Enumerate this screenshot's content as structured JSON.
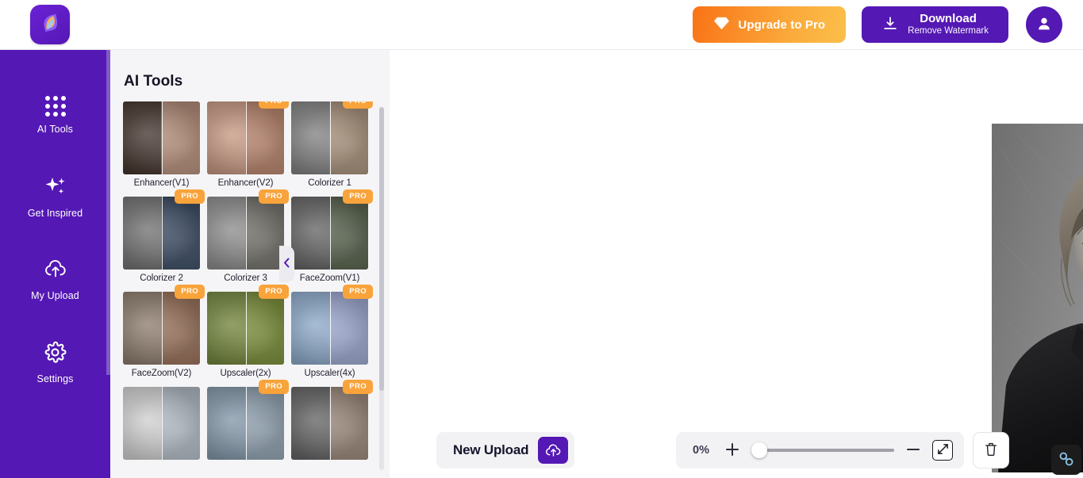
{
  "header": {
    "logo_icon": "app-logo-leaf-icon",
    "upgrade": {
      "label": "Upgrade to Pro",
      "icon": "diamond-icon",
      "gradient_from": "#f97316",
      "gradient_to": "#fbbf4a"
    },
    "download": {
      "label": "Download",
      "sublabel": "Remove Watermark",
      "icon": "download-icon",
      "color": "#5418b4"
    },
    "account": {
      "icon": "person-icon",
      "color": "#5418b4"
    }
  },
  "sidebar": {
    "bg_color": "#5418b4",
    "items": [
      {
        "label": "AI Tools",
        "icon": "grid-dots-icon"
      },
      {
        "label": "Get Inspired",
        "icon": "sparkles-icon"
      },
      {
        "label": "My Upload",
        "icon": "cloud-upload-icon"
      },
      {
        "label": "Settings",
        "icon": "gear-icon"
      }
    ]
  },
  "tools_panel": {
    "title": "AI Tools",
    "collapse_icon": "chevron-left-icon",
    "pro_badge_label": "PRO",
    "pro_badge_color": "#f9a33b",
    "tools": [
      {
        "label": "Enhancer(V1)",
        "pro": false
      },
      {
        "label": "Enhancer(V2)",
        "pro": true
      },
      {
        "label": "Colorizer 1",
        "pro": true
      },
      {
        "label": "Colorizer 2",
        "pro": true
      },
      {
        "label": "Colorizer 3",
        "pro": true
      },
      {
        "label": "FaceZoom(V1)",
        "pro": true
      },
      {
        "label": "FaceZoom(V2)",
        "pro": true
      },
      {
        "label": "Upscaler(2x)",
        "pro": true
      },
      {
        "label": "Upscaler(4x)",
        "pro": true
      },
      {
        "label": "",
        "pro": false
      },
      {
        "label": "",
        "pro": true
      },
      {
        "label": "",
        "pro": true
      }
    ]
  },
  "canvas": {
    "photo_description": "black-and-white portrait of a man leaning against a wall"
  },
  "bottom_bar": {
    "new_upload": {
      "label": "New Upload",
      "icon": "cloud-upload-icon"
    },
    "zoom": {
      "percent_label": "0%",
      "zoom_in_icon": "plus-icon",
      "zoom_out_icon": "minus-icon",
      "slider_value": 0,
      "fit_screen_icon": "expand-arrows-icon"
    },
    "delete": {
      "icon": "trash-icon"
    },
    "link": {
      "icon": "chain-link-icon"
    }
  }
}
